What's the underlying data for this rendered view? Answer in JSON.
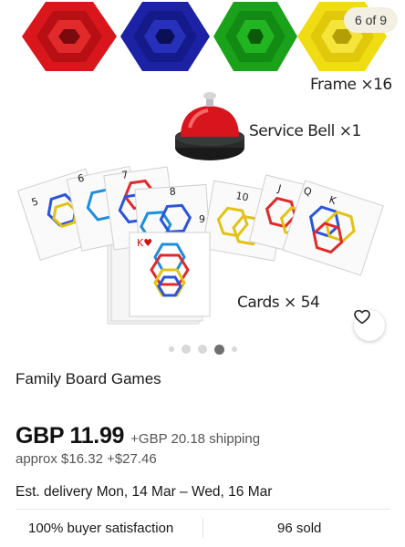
{
  "gallery": {
    "counter": "6 of 9",
    "labels": {
      "frame": "Frame ×16",
      "bell": "Service Bell ×1",
      "cards": "Cards × 54"
    },
    "frame_colors": [
      "#d9161c",
      "#1c22a6",
      "#1aa31a",
      "#f0dc12"
    ],
    "card_indices": [
      "5",
      "6",
      "7",
      "8",
      "9",
      "10",
      "J",
      "Q",
      "K"
    ],
    "card_suit": "♠",
    "front_card": "K♥",
    "dots_total": 5,
    "dot_active_index": 3
  },
  "icons": {
    "favorite": "heart-outline-icon"
  },
  "listing": {
    "title": "Family Board Games",
    "price": "GBP 11.99",
    "shipping": "+GBP 20.18 shipping",
    "approx": "approx $16.32 +$27.46",
    "delivery": "Est. delivery Mon, 14 Mar – Wed, 16 Mar",
    "satisfaction": "100% buyer satisfaction",
    "sold": "96 sold"
  },
  "colors": {
    "active_dot": "#6f6f6f",
    "badge_bg": "#f4efe3"
  }
}
